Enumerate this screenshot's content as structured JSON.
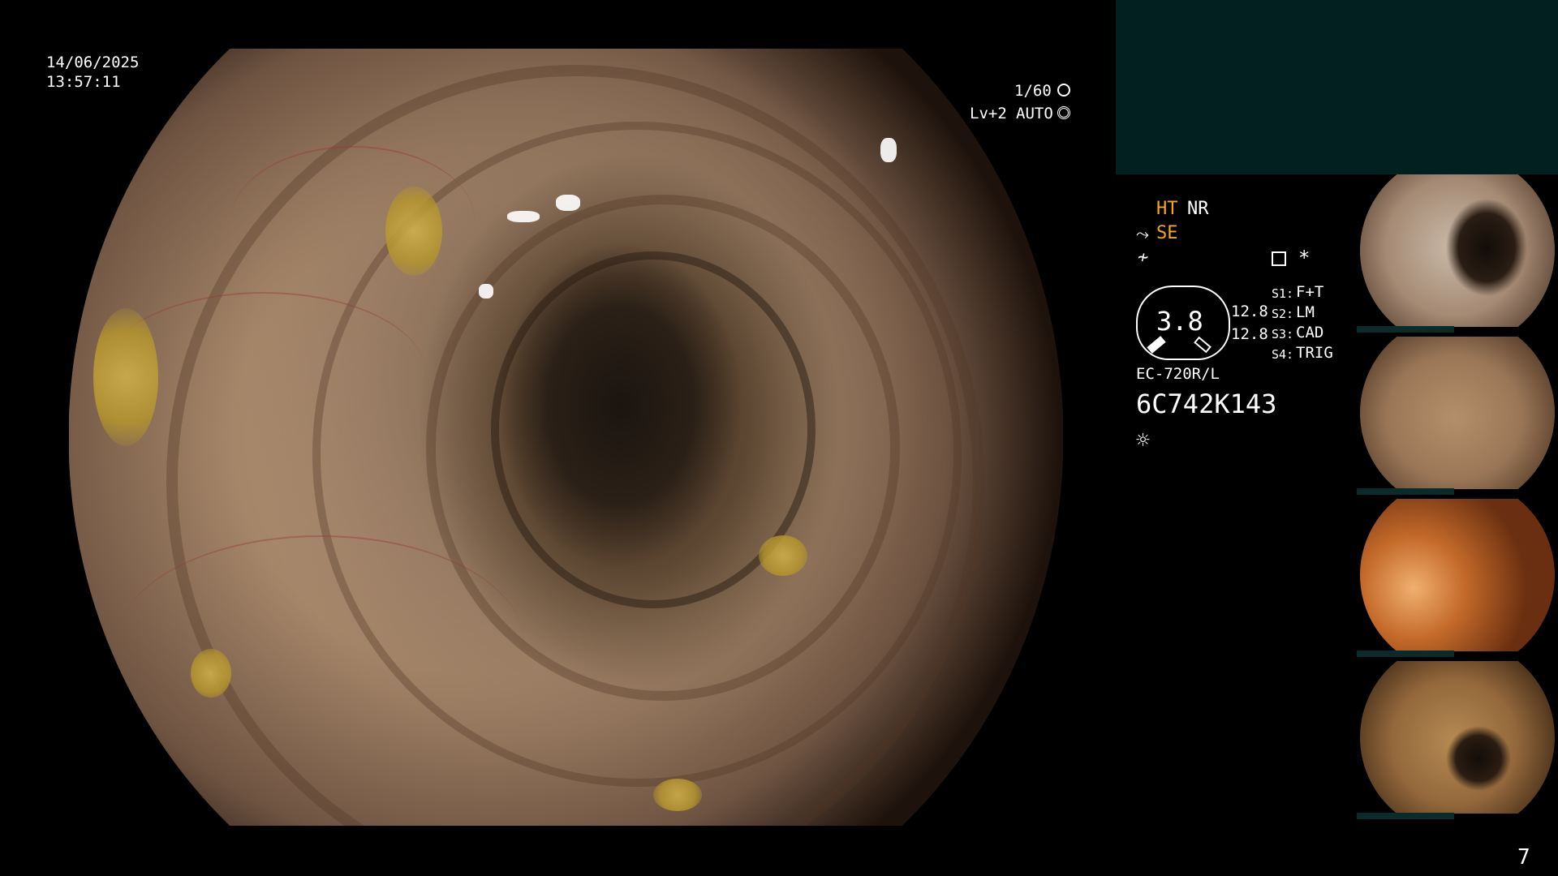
{
  "overlay": {
    "date": "14/06/2025",
    "time": "13:57:11",
    "shutter": "1/60",
    "shutter_icon": "aperture-icon",
    "level": "Lv+2",
    "mode": "AUTO",
    "mode_icon": "auto-iris-icon"
  },
  "panel": {
    "ht": "HT",
    "nr": "NR",
    "se": "SE",
    "se_icon": "scope-enhance-icon",
    "freeze_icon": "freeze-icon",
    "menu_icon": "menu-list-icon",
    "asterisk": "*",
    "gauge_value": "3.8",
    "val1": "12.8",
    "val2": "12.8",
    "s1_label": "S1:",
    "s1_value": "F+T",
    "s2_label": "S2:",
    "s2_value": "LM",
    "s3_label": "S3:",
    "s3_value": "CAD",
    "s4_label": "S4:",
    "s4_value": "TRIG",
    "scope_model": "EC-720R/L",
    "serial": "6C742K143",
    "light_icon": "brightness-icon",
    "page_number": "7"
  },
  "colors": {
    "accent": "#f5a623",
    "panel_bg": "#01201f"
  }
}
